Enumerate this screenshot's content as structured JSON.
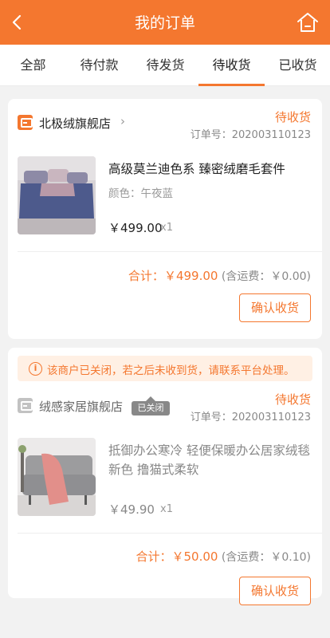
{
  "header": {
    "title": "我的订单",
    "back_icon": "chevron-left-icon",
    "home_icon": "home-icon",
    "bg": "#f4772f"
  },
  "tabs": [
    {
      "label": "全部"
    },
    {
      "label": "待付款"
    },
    {
      "label": "待发货"
    },
    {
      "label": "待收货",
      "active": true
    },
    {
      "label": "已收货"
    }
  ],
  "orders": [
    {
      "shop": "北极绒旗舰店",
      "status": "待收货",
      "order_no": "订单号：202003110123",
      "title": "高级莫兰迪色系 臻密绒磨毛套件",
      "spec": "颜色：午夜蓝",
      "price": "￥499.00",
      "qty": "x1",
      "total_label": "合计：",
      "total_amount": "￥499.00",
      "shipping": "(含运费：￥0.00)",
      "button": "确认收货"
    },
    {
      "notice": "该商户已关闭，若之后未收到货，请联系平台处理。",
      "shop": "绒感家居旗舰店",
      "shop_badge": "已关闭",
      "status": "待收货",
      "order_no": "订单号：202003110123",
      "title": "抵御办公寒冷 轻便保暖办公居家绒毯 新色 撸猫式柔软",
      "price": "￥49.90",
      "qty": "x1",
      "total_label": "合计：",
      "total_amount": "￥50.00",
      "shipping": "(含运费：￥0.10)",
      "button": "确认收货"
    }
  ]
}
